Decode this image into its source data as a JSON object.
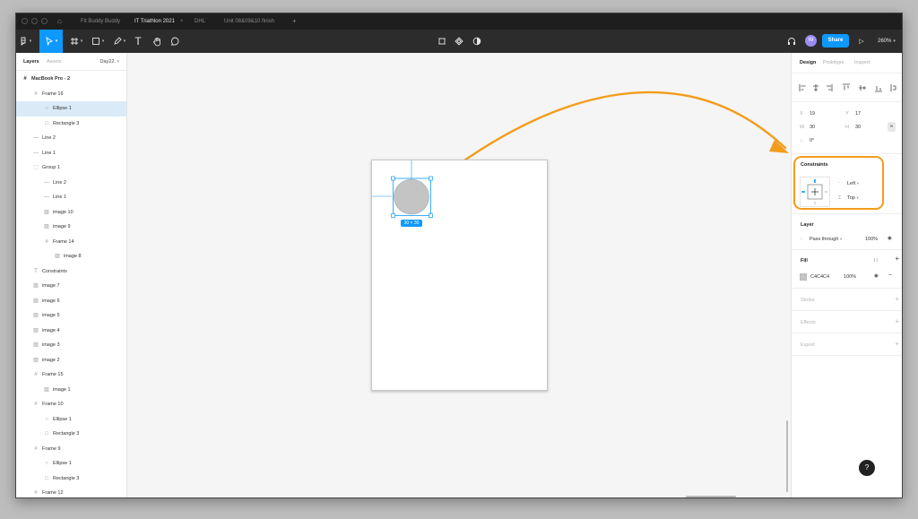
{
  "tabs": [
    {
      "label": "Fit Buddy Buddy",
      "active": false
    },
    {
      "label": "IT Triathlon 2021",
      "active": true
    },
    {
      "label": "DHL",
      "active": false
    },
    {
      "label": "Unit 08&09&10 finish",
      "active": false
    }
  ],
  "toolbar": {
    "share_label": "Share",
    "avatar_letter": "W",
    "zoom": "260%"
  },
  "layers_panel": {
    "tab_layers": "Layers",
    "tab_assets": "Assets",
    "page": "Day22.",
    "items": [
      {
        "label": "MacBook Pro - 2",
        "icon": "frame",
        "depth": 0,
        "selected": false
      },
      {
        "label": "Frame 16",
        "icon": "frame",
        "depth": 1,
        "selected": false
      },
      {
        "label": "Ellipse 1",
        "icon": "ellipse",
        "depth": 2,
        "selected": true
      },
      {
        "label": "Rectangle 3",
        "icon": "rectangle",
        "depth": 2,
        "selected": false
      },
      {
        "label": "Line 2",
        "icon": "line",
        "depth": 1,
        "selected": false
      },
      {
        "label": "Line 1",
        "icon": "line",
        "depth": 1,
        "selected": false
      },
      {
        "label": "Group 1",
        "icon": "group",
        "depth": 1,
        "selected": false
      },
      {
        "label": "Line 2",
        "icon": "line",
        "depth": 2,
        "selected": false
      },
      {
        "label": "Line 1",
        "icon": "line",
        "depth": 2,
        "selected": false
      },
      {
        "label": "image 10",
        "icon": "image",
        "depth": 2,
        "selected": false
      },
      {
        "label": "image 9",
        "icon": "image",
        "depth": 2,
        "selected": false
      },
      {
        "label": "Frame 14",
        "icon": "frame",
        "depth": 2,
        "selected": false
      },
      {
        "label": "image 8",
        "icon": "image",
        "depth": 3,
        "selected": false
      },
      {
        "label": "Constraints",
        "icon": "text",
        "depth": 1,
        "selected": false
      },
      {
        "label": "image 7",
        "icon": "image",
        "depth": 1,
        "selected": false
      },
      {
        "label": "image 6",
        "icon": "image",
        "depth": 1,
        "selected": false
      },
      {
        "label": "image 5",
        "icon": "image",
        "depth": 1,
        "selected": false
      },
      {
        "label": "image 4",
        "icon": "image",
        "depth": 1,
        "selected": false
      },
      {
        "label": "image 3",
        "icon": "image",
        "depth": 1,
        "selected": false
      },
      {
        "label": "image 2",
        "icon": "image",
        "depth": 1,
        "selected": false
      },
      {
        "label": "Frame 15",
        "icon": "frame",
        "depth": 1,
        "selected": false
      },
      {
        "label": "image 1",
        "icon": "image",
        "depth": 2,
        "selected": false
      },
      {
        "label": "Frame 10",
        "icon": "frame",
        "depth": 1,
        "selected": false
      },
      {
        "label": "Ellipse 1",
        "icon": "ellipse",
        "depth": 2,
        "selected": false
      },
      {
        "label": "Rectangle 3",
        "icon": "rectangle",
        "depth": 2,
        "selected": false
      },
      {
        "label": "Frame 9",
        "icon": "frame",
        "depth": 1,
        "selected": false
      },
      {
        "label": "Ellipse 1",
        "icon": "ellipse",
        "depth": 2,
        "selected": false
      },
      {
        "label": "Rectangle 3",
        "icon": "rectangle",
        "depth": 2,
        "selected": false
      },
      {
        "label": "Frame 12",
        "icon": "frame",
        "depth": 1,
        "selected": false
      }
    ]
  },
  "canvas": {
    "size_badge": "30 × 30",
    "ellipse_fill": "#C4C4C4",
    "selection_color": "#0D99FF",
    "annotation_color": "#F39C1B"
  },
  "design_panel": {
    "tabs": [
      "Design",
      "Prototype",
      "Inspect"
    ],
    "x_label": "X",
    "x_value": "19",
    "y_label": "Y",
    "y_value": "17",
    "w_label": "W",
    "w_value": "30",
    "h_label": "H",
    "h_value": "30",
    "rotation": "0°",
    "constraints": {
      "title": "Constraints",
      "horizontal": "Left",
      "vertical": "Top"
    },
    "layer": {
      "title": "Layer",
      "blend": "Pass through",
      "opacity": "100%"
    },
    "fill": {
      "title": "Fill",
      "hex": "C4C4C4",
      "opacity": "100%",
      "swatch": "#C4C4C4"
    },
    "stroke_title": "Stroke",
    "effects_title": "Effects",
    "export_title": "Export"
  },
  "help_label": "?"
}
